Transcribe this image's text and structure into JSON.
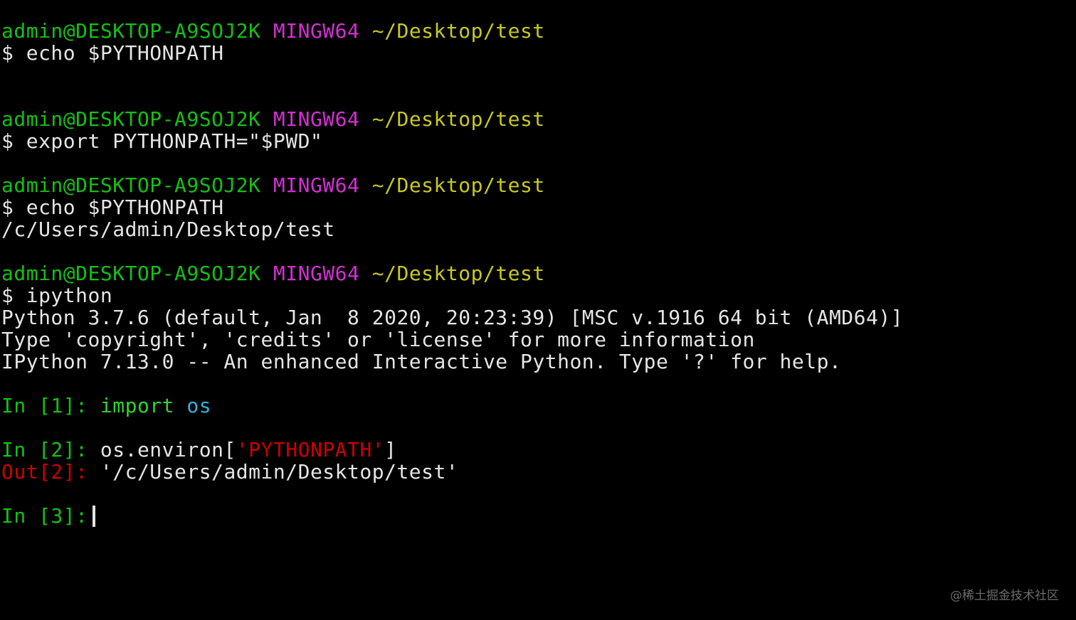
{
  "colors": {
    "background": "#000000",
    "user_host": "#13c113",
    "msystem": "#d32fd3",
    "cwd": "#c8c81f",
    "text": "#e5e5e5",
    "out_prompt": "#cd0000",
    "string_literal": "#cd0000"
  },
  "prompt": {
    "user_host": "admin@DESKTOP-A9SOJ2K",
    "msystem": "MINGW64",
    "cwd": "~/Desktop/test",
    "dollar": "$"
  },
  "commands": {
    "cmd1": "echo $PYTHONPATH",
    "cmd2": "export PYTHONPATH=\"$PWD\"",
    "cmd3": "echo $PYTHONPATH",
    "cmd3_output": "/c/Users/admin/Desktop/test",
    "cmd4": "ipython"
  },
  "ipython": {
    "banner1": "Python 3.7.6 (default, Jan  8 2020, 20:23:39) [MSC v.1916 64 bit (AMD64)]",
    "banner2": "Type 'copyright', 'credits' or 'license' for more information",
    "banner3": "IPython 7.13.0 -- An enhanced Interactive Python. Type '?' for help.",
    "in1_prompt": "In [1]:",
    "in1_kw": "import",
    "in1_name": "os",
    "in2_prompt": "In [2]:",
    "in2_pre": "os.environ[",
    "in2_str": "'PYTHONPATH'",
    "in2_post": "]",
    "out2_prompt": "Out[2]:",
    "out2_value": "'/c/Users/admin/Desktop/test'",
    "in3_prompt": "In [3]:"
  },
  "watermark": "@稀土掘金技术社区"
}
